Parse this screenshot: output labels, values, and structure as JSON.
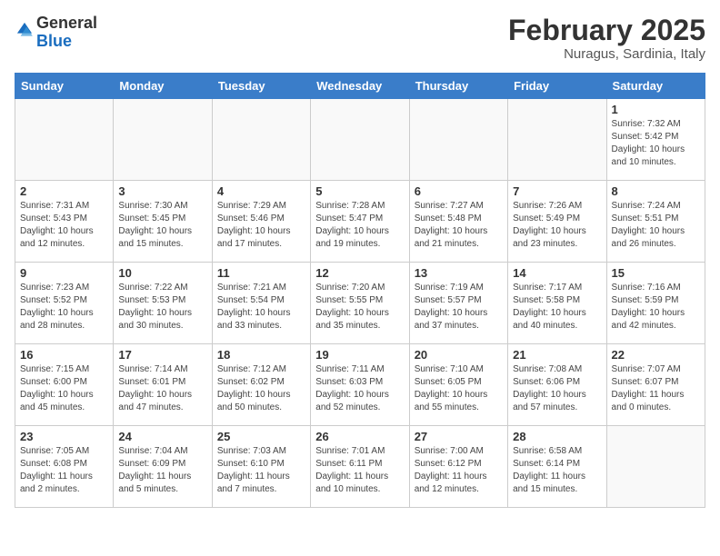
{
  "header": {
    "logo_general": "General",
    "logo_blue": "Blue",
    "month_year": "February 2025",
    "location": "Nuragus, Sardinia, Italy"
  },
  "days_of_week": [
    "Sunday",
    "Monday",
    "Tuesday",
    "Wednesday",
    "Thursday",
    "Friday",
    "Saturday"
  ],
  "weeks": [
    [
      {
        "day": "",
        "info": ""
      },
      {
        "day": "",
        "info": ""
      },
      {
        "day": "",
        "info": ""
      },
      {
        "day": "",
        "info": ""
      },
      {
        "day": "",
        "info": ""
      },
      {
        "day": "",
        "info": ""
      },
      {
        "day": "1",
        "info": "Sunrise: 7:32 AM\nSunset: 5:42 PM\nDaylight: 10 hours\nand 10 minutes."
      }
    ],
    [
      {
        "day": "2",
        "info": "Sunrise: 7:31 AM\nSunset: 5:43 PM\nDaylight: 10 hours\nand 12 minutes."
      },
      {
        "day": "3",
        "info": "Sunrise: 7:30 AM\nSunset: 5:45 PM\nDaylight: 10 hours\nand 15 minutes."
      },
      {
        "day": "4",
        "info": "Sunrise: 7:29 AM\nSunset: 5:46 PM\nDaylight: 10 hours\nand 17 minutes."
      },
      {
        "day": "5",
        "info": "Sunrise: 7:28 AM\nSunset: 5:47 PM\nDaylight: 10 hours\nand 19 minutes."
      },
      {
        "day": "6",
        "info": "Sunrise: 7:27 AM\nSunset: 5:48 PM\nDaylight: 10 hours\nand 21 minutes."
      },
      {
        "day": "7",
        "info": "Sunrise: 7:26 AM\nSunset: 5:49 PM\nDaylight: 10 hours\nand 23 minutes."
      },
      {
        "day": "8",
        "info": "Sunrise: 7:24 AM\nSunset: 5:51 PM\nDaylight: 10 hours\nand 26 minutes."
      }
    ],
    [
      {
        "day": "9",
        "info": "Sunrise: 7:23 AM\nSunset: 5:52 PM\nDaylight: 10 hours\nand 28 minutes."
      },
      {
        "day": "10",
        "info": "Sunrise: 7:22 AM\nSunset: 5:53 PM\nDaylight: 10 hours\nand 30 minutes."
      },
      {
        "day": "11",
        "info": "Sunrise: 7:21 AM\nSunset: 5:54 PM\nDaylight: 10 hours\nand 33 minutes."
      },
      {
        "day": "12",
        "info": "Sunrise: 7:20 AM\nSunset: 5:55 PM\nDaylight: 10 hours\nand 35 minutes."
      },
      {
        "day": "13",
        "info": "Sunrise: 7:19 AM\nSunset: 5:57 PM\nDaylight: 10 hours\nand 37 minutes."
      },
      {
        "day": "14",
        "info": "Sunrise: 7:17 AM\nSunset: 5:58 PM\nDaylight: 10 hours\nand 40 minutes."
      },
      {
        "day": "15",
        "info": "Sunrise: 7:16 AM\nSunset: 5:59 PM\nDaylight: 10 hours\nand 42 minutes."
      }
    ],
    [
      {
        "day": "16",
        "info": "Sunrise: 7:15 AM\nSunset: 6:00 PM\nDaylight: 10 hours\nand 45 minutes."
      },
      {
        "day": "17",
        "info": "Sunrise: 7:14 AM\nSunset: 6:01 PM\nDaylight: 10 hours\nand 47 minutes."
      },
      {
        "day": "18",
        "info": "Sunrise: 7:12 AM\nSunset: 6:02 PM\nDaylight: 10 hours\nand 50 minutes."
      },
      {
        "day": "19",
        "info": "Sunrise: 7:11 AM\nSunset: 6:03 PM\nDaylight: 10 hours\nand 52 minutes."
      },
      {
        "day": "20",
        "info": "Sunrise: 7:10 AM\nSunset: 6:05 PM\nDaylight: 10 hours\nand 55 minutes."
      },
      {
        "day": "21",
        "info": "Sunrise: 7:08 AM\nSunset: 6:06 PM\nDaylight: 10 hours\nand 57 minutes."
      },
      {
        "day": "22",
        "info": "Sunrise: 7:07 AM\nSunset: 6:07 PM\nDaylight: 11 hours\nand 0 minutes."
      }
    ],
    [
      {
        "day": "23",
        "info": "Sunrise: 7:05 AM\nSunset: 6:08 PM\nDaylight: 11 hours\nand 2 minutes."
      },
      {
        "day": "24",
        "info": "Sunrise: 7:04 AM\nSunset: 6:09 PM\nDaylight: 11 hours\nand 5 minutes."
      },
      {
        "day": "25",
        "info": "Sunrise: 7:03 AM\nSunset: 6:10 PM\nDaylight: 11 hours\nand 7 minutes."
      },
      {
        "day": "26",
        "info": "Sunrise: 7:01 AM\nSunset: 6:11 PM\nDaylight: 11 hours\nand 10 minutes."
      },
      {
        "day": "27",
        "info": "Sunrise: 7:00 AM\nSunset: 6:12 PM\nDaylight: 11 hours\nand 12 minutes."
      },
      {
        "day": "28",
        "info": "Sunrise: 6:58 AM\nSunset: 6:14 PM\nDaylight: 11 hours\nand 15 minutes."
      },
      {
        "day": "",
        "info": ""
      }
    ]
  ]
}
